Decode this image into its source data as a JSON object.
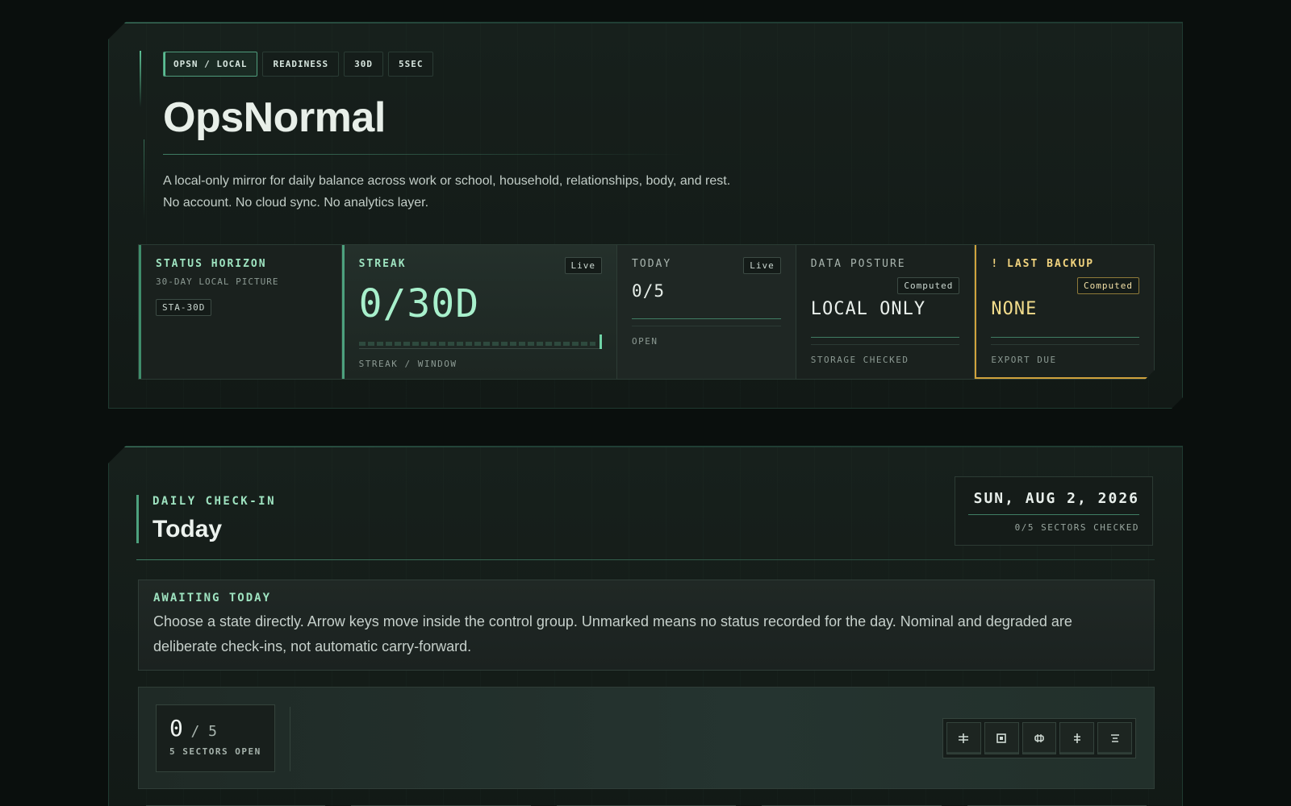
{
  "hero": {
    "tags": [
      "OPSN / LOCAL",
      "READINESS",
      "30D",
      "5SEC"
    ],
    "title": "OpsNormal",
    "desc_line1": "A local-only mirror for daily balance across work or school, household, relationships, body, and rest.",
    "desc_line2": "No account. No cloud sync. No analytics layer."
  },
  "metrics": {
    "horizon": {
      "label": "STATUS HORIZON",
      "sub": "30-DAY LOCAL PICTURE",
      "chip": "STA-30D"
    },
    "streak": {
      "label": "STREAK",
      "chip": "Live",
      "value": "0/30D",
      "progress": 0,
      "foot": "STREAK / WINDOW"
    },
    "today": {
      "label": "TODAY",
      "chip": "Live",
      "value": "0/5",
      "foot": "OPEN"
    },
    "posture": {
      "label": "DATA POSTURE",
      "chip": "Computed",
      "value": "LOCAL ONLY",
      "foot": "STORAGE CHECKED"
    },
    "backup": {
      "label": "! LAST BACKUP",
      "chip": "Computed",
      "value": "NONE",
      "foot": "EXPORT DUE"
    }
  },
  "colors": {
    "accent": "#9ee3c0",
    "warn": "#d0a23c",
    "bg": "#0a0f0d"
  },
  "checkin": {
    "kicker": "DAILY CHECK-IN",
    "title": "Today",
    "date": "SUN, AUG 2, 2026",
    "date_sub": "0/5 SECTORS CHECKED",
    "notice_kicker": "AWAITING TODAY",
    "notice_text": "Choose a state directly. Arrow keys move inside the control group. Unmarked means no status recorded for the day. Nominal and degraded are deliberate check-ins, not automatic carry-forward.",
    "counter_num": "0",
    "counter_den": "/ 5",
    "counter_sub": "5 SECTORS OPEN",
    "view_icons": [
      "align-horizontal-icon",
      "square-frame-icon",
      "align-center-icon",
      "align-vertical-icon",
      "list-center-icon"
    ]
  }
}
